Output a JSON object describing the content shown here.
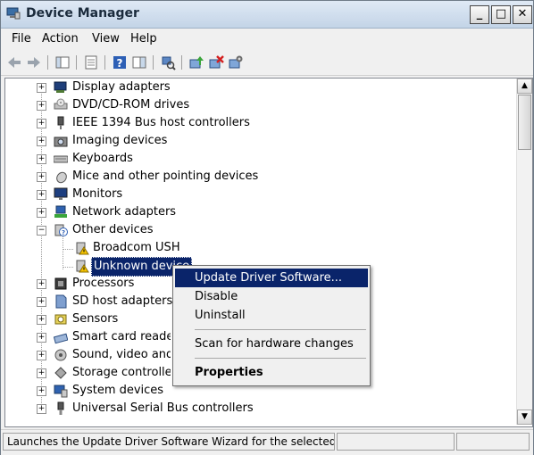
{
  "window": {
    "title": "Device Manager"
  },
  "menubar": {
    "items": [
      "File",
      "Action",
      "View",
      "Help"
    ]
  },
  "tree": {
    "items": [
      {
        "label": "Display adapters",
        "icon": "display-adapter-icon"
      },
      {
        "label": "DVD/CD-ROM drives",
        "icon": "dvd-drive-icon"
      },
      {
        "label": "IEEE 1394 Bus host controllers",
        "icon": "ieee1394-icon"
      },
      {
        "label": "Imaging devices",
        "icon": "camera-icon"
      },
      {
        "label": "Keyboards",
        "icon": "keyboard-icon"
      },
      {
        "label": "Mice and other pointing devices",
        "icon": "mouse-icon"
      },
      {
        "label": "Monitors",
        "icon": "monitor-icon"
      },
      {
        "label": "Network adapters",
        "icon": "network-adapter-icon"
      },
      {
        "label": "Other devices",
        "icon": "unknown-device-category-icon",
        "expanded": true,
        "children": [
          {
            "label": "Broadcom USH",
            "icon": "warning-device-icon"
          },
          {
            "label": "Unknown device",
            "icon": "warning-device-icon",
            "selected": true
          }
        ]
      },
      {
        "label": "Processors",
        "icon": "processor-icon"
      },
      {
        "label": "SD host adapters",
        "icon": "sd-card-icon"
      },
      {
        "label": "Sensors",
        "icon": "sensor-icon"
      },
      {
        "label": "Smart card readers",
        "icon": "smart-card-icon"
      },
      {
        "label": "Sound, video and game controllers",
        "icon": "sound-icon"
      },
      {
        "label": "Storage controllers",
        "icon": "storage-controller-icon"
      },
      {
        "label": "System devices",
        "icon": "system-devices-icon"
      },
      {
        "label": "Universal Serial Bus controllers",
        "icon": "usb-icon"
      }
    ]
  },
  "context_menu": {
    "update_driver": "Update Driver Software...",
    "disable": "Disable",
    "uninstall": "Uninstall",
    "scan": "Scan for hardware changes",
    "properties": "Properties"
  },
  "statusbar": {
    "text": "Launches the Update Driver Software Wizard for the selected device."
  },
  "colors": {
    "selection": "#0a246a",
    "title_gradient_top": "#dfe9f5"
  }
}
